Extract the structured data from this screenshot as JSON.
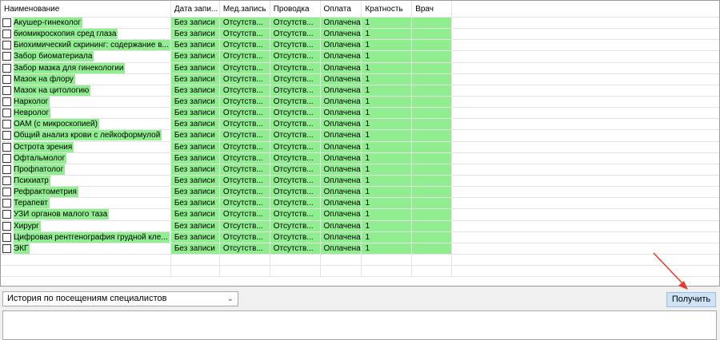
{
  "grid": {
    "columns": [
      "Наименование",
      "Дата запи...",
      "Мед.запись",
      "Проводка",
      "Оплата",
      "Кратность",
      "Врач"
    ],
    "rows": [
      {
        "name": "Акушер-гинеколог",
        "date": "Без записи",
        "med": "Отсутств...",
        "prov": "Отсутств...",
        "pay": "Оплачена",
        "mult": "1",
        "doctor": ""
      },
      {
        "name": "биомикроскопия сред глаза",
        "date": "Без записи",
        "med": "Отсутств...",
        "prov": "Отсутств...",
        "pay": "Оплачена",
        "mult": "1",
        "doctor": ""
      },
      {
        "name": "Биохимический скрининг: содержание в...",
        "date": "Без записи",
        "med": "Отсутств...",
        "prov": "Отсутств...",
        "pay": "Оплачена",
        "mult": "1",
        "doctor": ""
      },
      {
        "name": "Забор биоматериала",
        "date": "Без записи",
        "med": "Отсутств...",
        "prov": "Отсутств...",
        "pay": "Оплачена",
        "mult": "1",
        "doctor": ""
      },
      {
        "name": "Забор мазка для гинекологии",
        "date": "Без записи",
        "med": "Отсутств...",
        "prov": "Отсутств...",
        "pay": "Оплачена",
        "mult": "1",
        "doctor": ""
      },
      {
        "name": "Мазок на флору",
        "date": "Без записи",
        "med": "Отсутств...",
        "prov": "Отсутств...",
        "pay": "Оплачена",
        "mult": "1",
        "doctor": ""
      },
      {
        "name": "Мазок на цитологию",
        "date": "Без записи",
        "med": "Отсутств...",
        "prov": "Отсутств...",
        "pay": "Оплачена",
        "mult": "1",
        "doctor": ""
      },
      {
        "name": "Нарколог",
        "date": "Без записи",
        "med": "Отсутств...",
        "prov": "Отсутств...",
        "pay": "Оплачена",
        "mult": "1",
        "doctor": ""
      },
      {
        "name": "Невролог",
        "date": "Без записи",
        "med": "Отсутств...",
        "prov": "Отсутств...",
        "pay": "Оплачена",
        "mult": "1",
        "doctor": ""
      },
      {
        "name": "ОАМ (с микроскопией)",
        "date": "Без записи",
        "med": "Отсутств...",
        "prov": "Отсутств...",
        "pay": "Оплачена",
        "mult": "1",
        "doctor": ""
      },
      {
        "name": "Общий анализ крови с лейкоформулой",
        "date": "Без записи",
        "med": "Отсутств...",
        "prov": "Отсутств...",
        "pay": "Оплачена",
        "mult": "1",
        "doctor": ""
      },
      {
        "name": "Острота зрения",
        "date": "Без записи",
        "med": "Отсутств...",
        "prov": "Отсутств...",
        "pay": "Оплачена",
        "mult": "1",
        "doctor": ""
      },
      {
        "name": "Офтальмолог",
        "date": "Без записи",
        "med": "Отсутств...",
        "prov": "Отсутств...",
        "pay": "Оплачена",
        "mult": "1",
        "doctor": ""
      },
      {
        "name": "Профпатолог",
        "date": "Без записи",
        "med": "Отсутств...",
        "prov": "Отсутств...",
        "pay": "Оплачена",
        "mult": "1",
        "doctor": ""
      },
      {
        "name": "Психиатр",
        "date": "Без записи",
        "med": "Отсутств...",
        "prov": "Отсутств...",
        "pay": "Оплачена",
        "mult": "1",
        "doctor": ""
      },
      {
        "name": "Рефрактометрия",
        "date": "Без записи",
        "med": "Отсутств...",
        "prov": "Отсутств...",
        "pay": "Оплачена",
        "mult": "1",
        "doctor": ""
      },
      {
        "name": "Терапевт",
        "date": "Без записи",
        "med": "Отсутств...",
        "prov": "Отсутств...",
        "pay": "Оплачена",
        "mult": "1",
        "doctor": ""
      },
      {
        "name": "УЗИ органов малого таза",
        "date": "Без записи",
        "med": "Отсутств...",
        "prov": "Отсутств...",
        "pay": "Оплачена",
        "mult": "1",
        "doctor": ""
      },
      {
        "name": "Хирург",
        "date": "Без записи",
        "med": "Отсутств...",
        "prov": "Отсутств...",
        "pay": "Оплачена",
        "mult": "1",
        "doctor": ""
      },
      {
        "name": "Цифровая рентгенография грудной кле...",
        "date": "Без записи",
        "med": "Отсутств...",
        "prov": "Отсутств...",
        "pay": "Оплачена",
        "mult": "1",
        "doctor": ""
      },
      {
        "name": "ЭКГ",
        "date": "Без записи",
        "med": "Отсутств...",
        "prov": "Отсутств...",
        "pay": "Оплачена",
        "mult": "1",
        "doctor": ""
      }
    ]
  },
  "history_select": {
    "value": "История по посещениям специалистов"
  },
  "get_button": {
    "label": "Получить"
  },
  "colors": {
    "row_highlight": "#90ee90",
    "button_bg": "#cfe3f7",
    "annotation_arrow": "#e53935"
  },
  "icons": {
    "dropdown": "chevron-down-icon",
    "checkbox": "checkbox-icon"
  }
}
